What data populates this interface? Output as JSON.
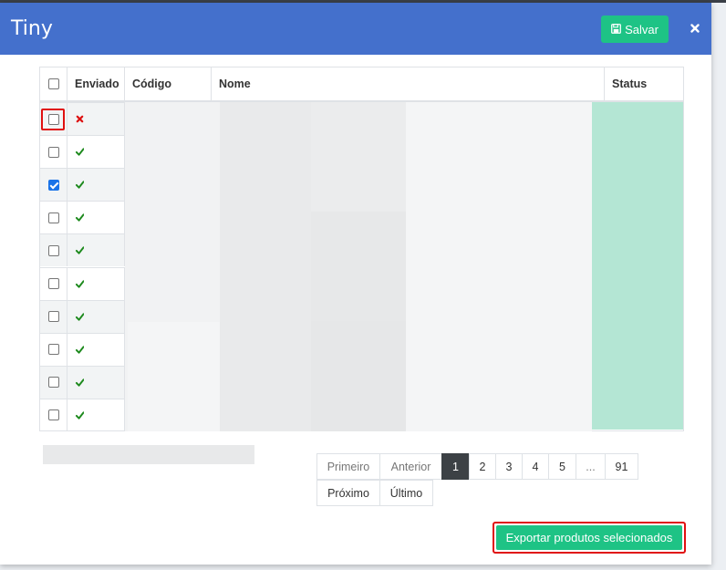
{
  "header": {
    "title": "Tiny",
    "save_label": "Salvar",
    "save_icon": "save-icon",
    "close_icon": "close-icon",
    "accent": "#4470cc",
    "button_color": "#1ec385"
  },
  "table": {
    "columns": [
      "Enviado",
      "Código",
      "Nome",
      "Status"
    ],
    "rows": [
      {
        "checked": false,
        "sent": false
      },
      {
        "checked": false,
        "sent": true
      },
      {
        "checked": true,
        "sent": true
      },
      {
        "checked": false,
        "sent": true
      },
      {
        "checked": false,
        "sent": true
      },
      {
        "checked": false,
        "sent": true
      },
      {
        "checked": false,
        "sent": true
      },
      {
        "checked": false,
        "sent": true
      },
      {
        "checked": false,
        "sent": true
      },
      {
        "checked": false,
        "sent": true
      }
    ],
    "status_color": "#b4e6d4",
    "sent_color": "#1e8a1e",
    "not_sent_color": "#dd1111"
  },
  "pagination": {
    "first": "Primeiro",
    "previous": "Anterior",
    "pages": [
      "1",
      "2",
      "3",
      "4",
      "5",
      "...",
      "91"
    ],
    "active_page": "1",
    "next": "Próximo",
    "last": "Último"
  },
  "footer": {
    "export_label": "Exportar produtos selecionados"
  }
}
